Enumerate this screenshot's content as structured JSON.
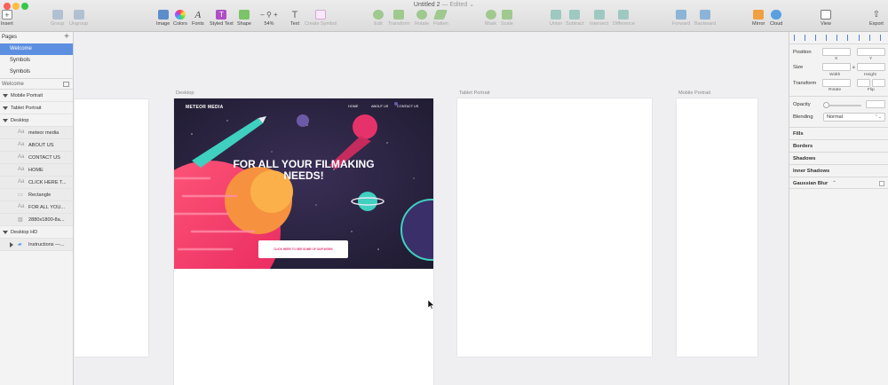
{
  "window": {
    "title": "Untitled 2",
    "status": "— Edited",
    "colors": {
      "close": "#fc605b",
      "minimize": "#fdbc40",
      "zoom": "#34c84a",
      "selection": "#5d8fe0"
    }
  },
  "toolbar": {
    "insert": "Insert",
    "group": "Group",
    "ungroup": "Ungroup",
    "image": "Image",
    "colors": "Colors",
    "fonts": "Fonts",
    "styled_text": "Styled Text",
    "shape": "Shape",
    "zoom_value": "54%",
    "text": "Text",
    "create_symbol": "Create Symbol",
    "edit": "Edit",
    "transform": "Transform",
    "rotate": "Rotate",
    "flatten": "Flatten",
    "mask": "Mask",
    "scale": "Scale",
    "union": "Union",
    "subtract": "Subtract",
    "intersect": "Intersect",
    "difference": "Difference",
    "forward": "Forward",
    "backward": "Backward",
    "mirror": "Mirror",
    "cloud": "Cloud",
    "view": "View",
    "export": "Export"
  },
  "pages": {
    "header": "Pages",
    "items": [
      "Welcome",
      "Symbols",
      "Symbols"
    ],
    "selected": "Welcome"
  },
  "layers": {
    "header": "Welcome",
    "items": [
      {
        "label": "Mobile Portrait",
        "kind": "board"
      },
      {
        "label": "Tablet Portrait",
        "kind": "board"
      },
      {
        "label": "Desktop",
        "kind": "board"
      },
      {
        "label": "meteor media",
        "kind": "text"
      },
      {
        "label": "ABOUT US",
        "kind": "text"
      },
      {
        "label": "CONTACT US",
        "kind": "text"
      },
      {
        "label": "HOME",
        "kind": "text"
      },
      {
        "label": "CLICK HERE T...",
        "kind": "text"
      },
      {
        "label": "Rectangle",
        "kind": "shape"
      },
      {
        "label": "FOR ALL YOU...",
        "kind": "text"
      },
      {
        "label": "2880x1800-8a...",
        "kind": "image"
      },
      {
        "label": "Desktop HD",
        "kind": "board"
      },
      {
        "label": "Instructions —...",
        "kind": "group"
      }
    ]
  },
  "canvas": {
    "artboards": {
      "desktop": "Desktop",
      "tablet": "Tablet Portrait",
      "mobile": "Mobile Portrait"
    },
    "hero": {
      "brand": "METEOR MEDIA",
      "nav": [
        "HOME",
        "ABOUT US",
        "CONTACT US"
      ],
      "headline_1": "FOR ALL YOUR FILMAKING",
      "headline_2": "NEEDS!",
      "cta": "CLICK HERE TO SEE SOME OF OUR WORK"
    }
  },
  "inspector": {
    "position": "Position",
    "x": "X",
    "y": "Y",
    "size": "Size",
    "width": "Width",
    "height": "Height",
    "transform": "Transform",
    "rotate": "Rotate",
    "flip": "Flip",
    "opacity": "Opacity",
    "blending": "Blending",
    "blending_value": "Normal",
    "sections": [
      "Fills",
      "Borders",
      "Shadows",
      "Inner Shadows",
      "Gaussian Blur"
    ]
  }
}
